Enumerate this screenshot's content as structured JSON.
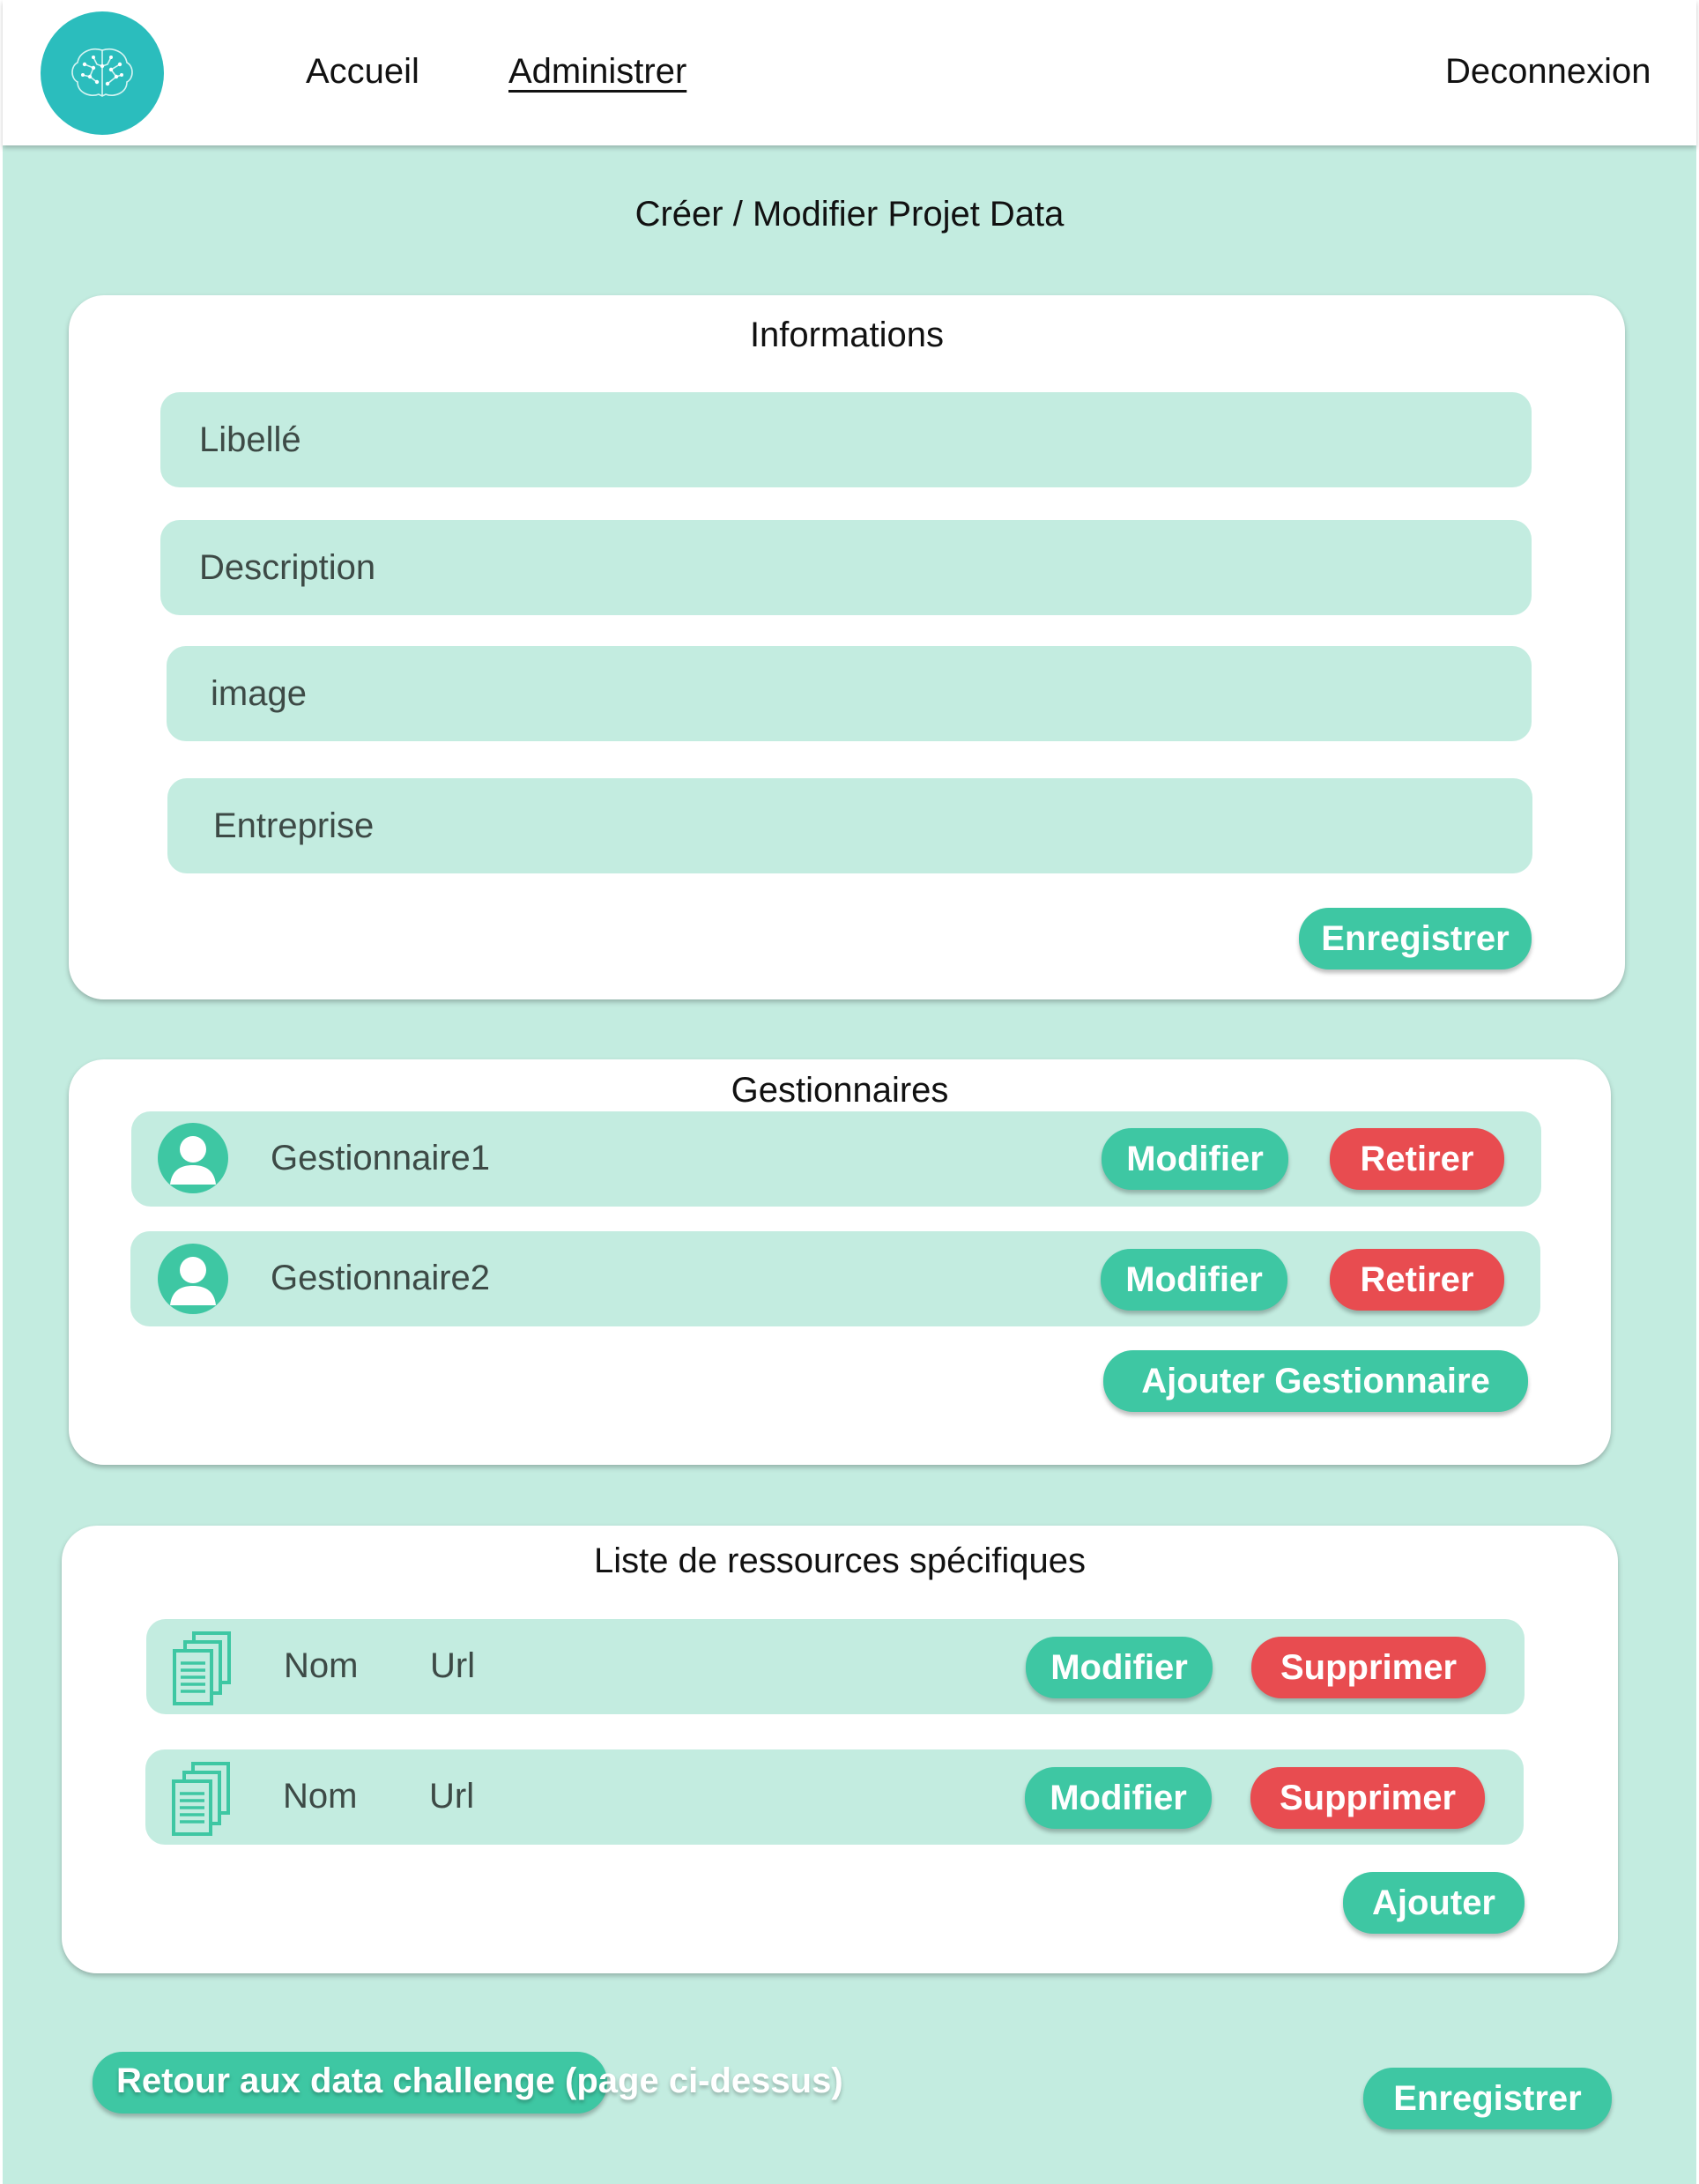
{
  "header": {
    "logo_icon": "brain-circuit-icon",
    "nav": [
      {
        "label": "Accueil",
        "active": false
      },
      {
        "label": "Administrer",
        "active": true
      }
    ],
    "logout_label": "Deconnexion"
  },
  "page_title": "Créer / Modifier Projet Data",
  "informations": {
    "title": "Informations",
    "fields": [
      {
        "placeholder": "Libellé",
        "value": ""
      },
      {
        "placeholder": "Description",
        "value": ""
      },
      {
        "placeholder": "image",
        "value": ""
      },
      {
        "placeholder": "Entreprise",
        "value": ""
      }
    ],
    "save_label": "Enregistrer"
  },
  "gestionnaires": {
    "title": "Gestionnaires",
    "items": [
      {
        "name": "Gestionnaire1",
        "icon": "user-avatar-icon",
        "edit_label": "Modifier",
        "remove_label": "Retirer"
      },
      {
        "name": "Gestionnaire2",
        "icon": "user-avatar-icon",
        "edit_label": "Modifier",
        "remove_label": "Retirer"
      }
    ],
    "add_label": "Ajouter Gestionnaire"
  },
  "ressources": {
    "title": "Liste de ressources spécifiques",
    "items": [
      {
        "name": "Nom",
        "url": "Url",
        "icon": "documents-icon",
        "edit_label": "Modifier",
        "delete_label": "Supprimer"
      },
      {
        "name": "Nom",
        "url": "Url",
        "icon": "documents-icon",
        "edit_label": "Modifier",
        "delete_label": "Supprimer"
      }
    ],
    "add_label": "Ajouter"
  },
  "footer": {
    "back_label": "Retour aux data challenge (page ci-dessus)",
    "save_label": "Enregistrer"
  },
  "colors": {
    "background": "#c3ece0",
    "accent_green": "#3ec7a3",
    "danger_red": "#e84c50",
    "logo_teal": "#2bbdbd"
  }
}
